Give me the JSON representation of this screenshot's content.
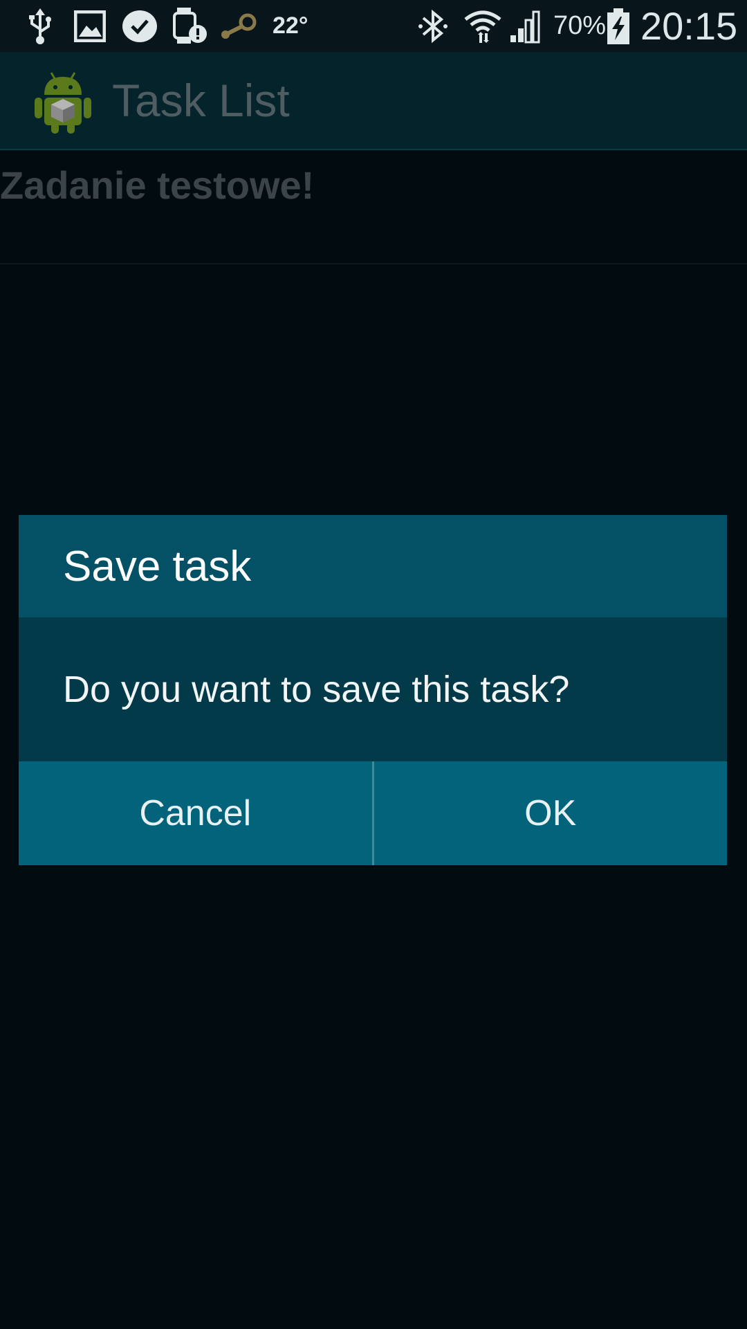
{
  "status_bar": {
    "temperature": "22°",
    "battery_percent": "70%",
    "time": "20:15",
    "left_icons": [
      "usb-icon",
      "gallery-icon",
      "check-bubble-icon",
      "watch-alert-icon",
      "steam-icon"
    ],
    "right_icons": [
      "bluetooth-icon",
      "wifi-icon",
      "signal-icon",
      "battery-charging-icon"
    ]
  },
  "app_bar": {
    "title": "Task List",
    "icon": "android-app-icon"
  },
  "tasks": [
    {
      "title": "Zadanie testowe!"
    }
  ],
  "dialog": {
    "title": "Save task",
    "message": "Do you want to save this task?",
    "cancel_label": "Cancel",
    "ok_label": "OK"
  },
  "colors": {
    "dialog_header": "#045165",
    "dialog_body": "#033a4a",
    "dialog_buttons": "#02637a",
    "app_bar": "#04232b",
    "background": "#020b10"
  }
}
